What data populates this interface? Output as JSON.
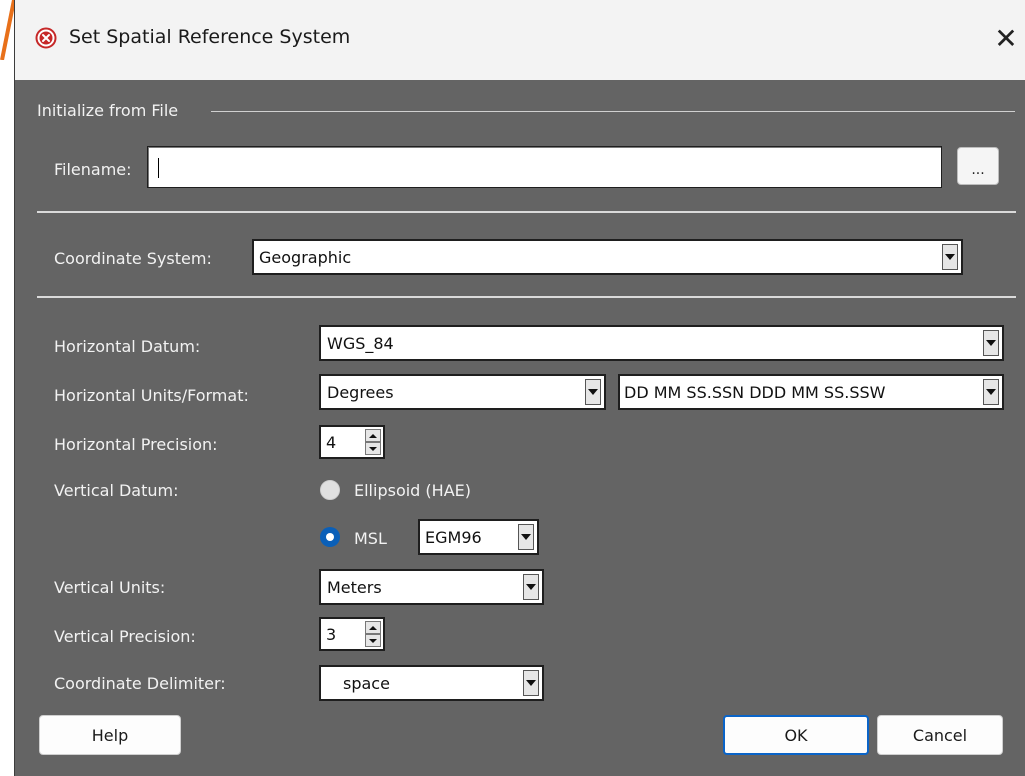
{
  "window": {
    "title": "Set Spatial Reference System"
  },
  "init_group": {
    "label": "Initialize from File",
    "filename_label": "Filename:",
    "filename_value": "",
    "browse_label": "..."
  },
  "coordinate_system": {
    "label": "Coordinate System:",
    "value": "Geographic"
  },
  "horizontal_datum": {
    "label": "Horizontal Datum:",
    "value": "WGS_84"
  },
  "horizontal_units": {
    "label": "Horizontal Units/Format:",
    "units_value": "Degrees",
    "format_value": "DD MM SS.SSN DDD MM SS.SSW"
  },
  "horizontal_precision": {
    "label": "Horizontal Precision:",
    "value": "4"
  },
  "vertical_datum": {
    "label": "Vertical Datum:",
    "ellipsoid_label": "Ellipsoid (HAE)",
    "msl_label": "MSL",
    "msl_model": "EGM96",
    "selected": "MSL"
  },
  "vertical_units": {
    "label": "Vertical Units:",
    "value": "Meters"
  },
  "vertical_precision": {
    "label": "Vertical Precision:",
    "value": "3"
  },
  "coordinate_delimiter": {
    "label": "Coordinate Delimiter:",
    "value": "space"
  },
  "buttons": {
    "help": "Help",
    "ok": "OK",
    "cancel": "Cancel"
  },
  "colors": {
    "dialog_bg": "#646464",
    "titlebar_bg": "#f3f3f3",
    "accent": "#0a5fb8",
    "app_icon": "#c62828",
    "corner_mark": "#e8701a"
  },
  "icons": {
    "app": "error-x-icon",
    "close": "close-icon"
  }
}
